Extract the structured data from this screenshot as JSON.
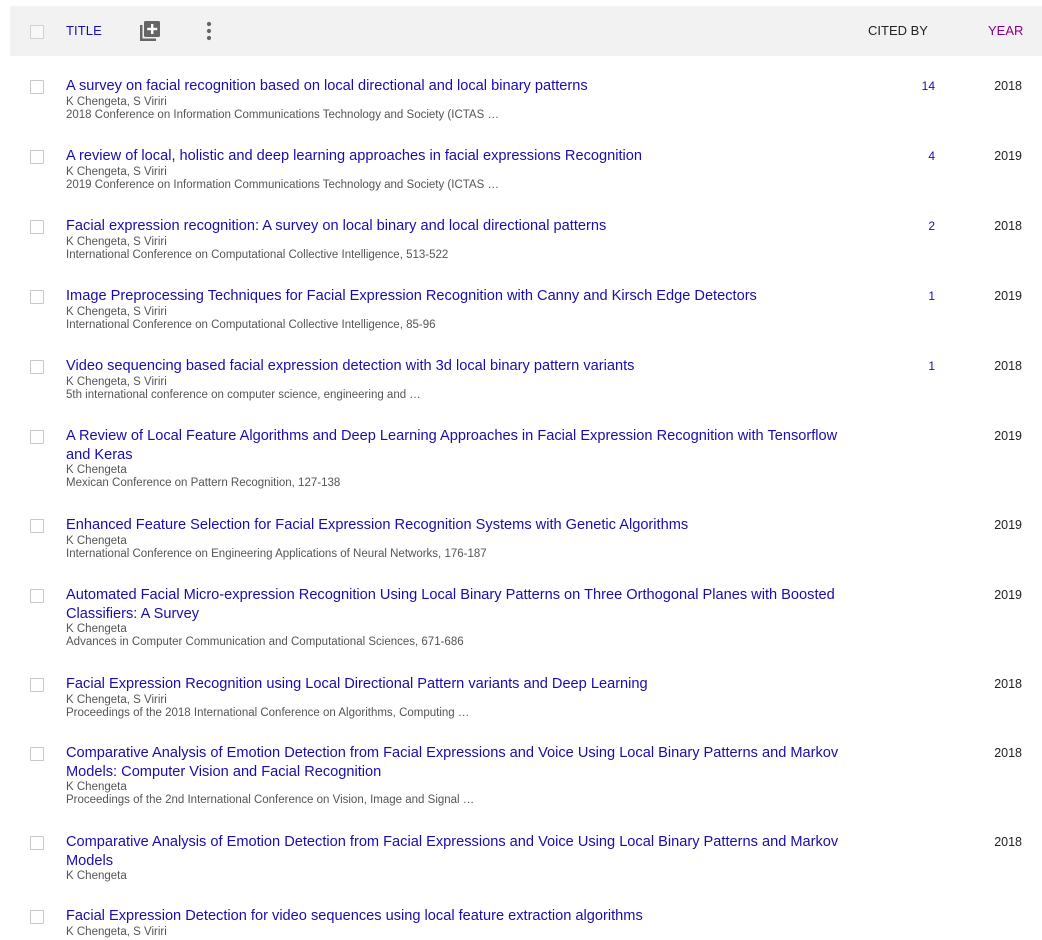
{
  "header": {
    "title_label": "TITLE",
    "cited_by_label": "CITED BY",
    "year_label": "YEAR",
    "add_icon": "add-box-icon",
    "more_icon": "more-vertical-icon"
  },
  "colors": {
    "link": "#1a0dab",
    "year_header": "#8b008b",
    "header_bg": "#f2f2f2"
  },
  "articles": [
    {
      "title": "A survey on facial recognition based on local directional and local binary patterns",
      "authors": "K Chengeta, S Viriri",
      "venue": "2018 Conference on Information Communications Technology and Society (ICTAS …",
      "cited_by": "14",
      "year": "2018"
    },
    {
      "title": "A review of local, holistic and deep learning approaches in facial expressions Recognition",
      "authors": "K Chengeta, S Viriri",
      "venue": "2019 Conference on Information Communications Technology and Society (ICTAS …",
      "cited_by": "4",
      "year": "2019"
    },
    {
      "title": "Facial expression recognition: A survey on local binary and local directional patterns",
      "authors": "K Chengeta, S Viriri",
      "venue": "International Conference on Computational Collective Intelligence, 513-522",
      "cited_by": "2",
      "year": "2018"
    },
    {
      "title": "Image Preprocessing Techniques for Facial Expression Recognition with Canny and Kirsch Edge Detectors",
      "authors": "K Chengeta, S Viriri",
      "venue": "International Conference on Computational Collective Intelligence, 85-96",
      "cited_by": "1",
      "year": "2019"
    },
    {
      "title": "Video sequencing based facial expression detection with 3d local binary pattern variants",
      "authors": "K Chengeta, S Viriri",
      "venue": "5th international conference on computer science, engineering and …",
      "cited_by": "1",
      "year": "2018"
    },
    {
      "title": "A Review of Local Feature Algorithms and Deep Learning Approaches in Facial Expression Recognition with Tensorflow and Keras",
      "authors": "K Chengeta",
      "venue": "Mexican Conference on Pattern Recognition, 127-138",
      "cited_by": "",
      "year": "2019"
    },
    {
      "title": "Enhanced Feature Selection for Facial Expression Recognition Systems with Genetic Algorithms",
      "authors": "K Chengeta",
      "venue": "International Conference on Engineering Applications of Neural Networks, 176-187",
      "cited_by": "",
      "year": "2019"
    },
    {
      "title": "Automated Facial Micro-expression Recognition Using Local Binary Patterns on Three Orthogonal Planes with Boosted Classifiers: A Survey",
      "authors": "K Chengeta",
      "venue": "Advances in Computer Communication and Computational Sciences, 671-686",
      "cited_by": "",
      "year": "2019"
    },
    {
      "title": "Facial Expression Recognition using Local Directional Pattern variants and Deep Learning",
      "authors": "K Chengeta, S Viriri",
      "venue": "Proceedings of the 2018 International Conference on Algorithms, Computing …",
      "cited_by": "",
      "year": "2018"
    },
    {
      "title": "Comparative Analysis of Emotion Detection from Facial Expressions and Voice Using Local Binary Patterns and Markov Models: Computer Vision and Facial Recognition",
      "authors": "K Chengeta",
      "venue": "Proceedings of the 2nd International Conference on Vision, Image and Signal …",
      "cited_by": "",
      "year": "2018"
    },
    {
      "title": "Comparative Analysis of Emotion Detection from Facial Expressions and Voice Using Local Binary Patterns and Markov Models",
      "authors": "K Chengeta",
      "venue": "",
      "cited_by": "",
      "year": "2018"
    },
    {
      "title": "Facial Expression Detection for video sequences using local feature extraction algorithms",
      "authors": "K Chengeta, S Viriri",
      "venue": "",
      "cited_by": "",
      "year": ""
    }
  ]
}
